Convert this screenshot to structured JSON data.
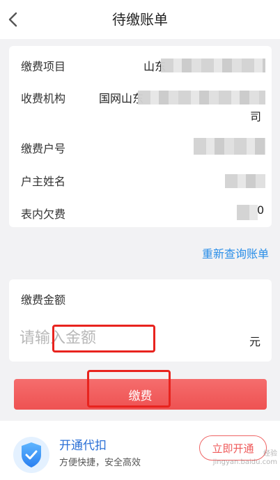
{
  "header": {
    "title": "待缴账单"
  },
  "bill": {
    "rows": [
      {
        "label": "缴费项目",
        "value": "山东"
      },
      {
        "label": "收费机构",
        "value": "国网山东",
        "value_tail": "司"
      },
      {
        "label": "缴费户号",
        "value": ""
      },
      {
        "label": "户主姓名",
        "value": ""
      },
      {
        "label": "表内欠费",
        "value": "0"
      }
    ]
  },
  "requery": {
    "label": "重新查询账单"
  },
  "amount": {
    "label": "缴费金额",
    "placeholder": "请输入金额",
    "value": "",
    "unit": "元"
  },
  "pay": {
    "label": "缴费"
  },
  "auto_debit": {
    "title": "开通代扣",
    "subtitle": "方便快捷，安全高效",
    "button_label": "立即开通"
  },
  "watermark": {
    "line1": "经验",
    "line2": "jingyan.baidu.com"
  },
  "colors": {
    "accent_red": "#ef5a5a",
    "link_blue": "#2a8ee8",
    "highlight_frame": "#e8231e"
  },
  "icons": {
    "back": "chevron-left-icon",
    "auto_debit": "shield-check-icon"
  }
}
